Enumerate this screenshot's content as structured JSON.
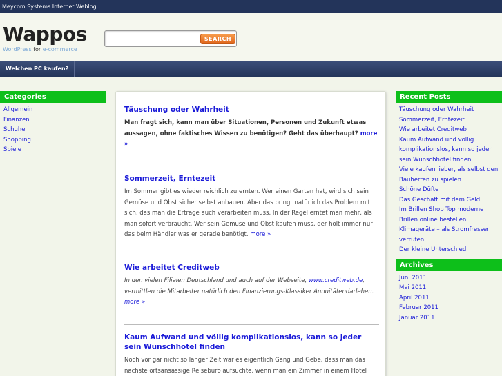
{
  "topbar": {
    "text": "Meycom Systems Internet Weblog"
  },
  "header": {
    "logo": "Wappos",
    "tagline_a": "WordPress",
    "tagline_for": "for",
    "tagline_b": "e-commerce",
    "search_value": "",
    "search_button": "SEARCH"
  },
  "nav": {
    "items": [
      {
        "label": "Welchen PC kaufen?"
      }
    ]
  },
  "categories": {
    "title": "Categories",
    "items": [
      "Allgemein",
      "Finanzen",
      "Schuhe",
      "Shopping",
      "Spiele"
    ]
  },
  "posts": [
    {
      "title": "Täuschung oder Wahrheit",
      "excerpt": "Man fragt sich, kann man über Situationen, Personen und Zukunft etwas aussagen, ohne faktisches Wissen zu benötigen? Geht das überhaupt?",
      "more": "more »"
    },
    {
      "title": "Sommerzeit, Erntezeit",
      "excerpt": "Im Sommer gibt es wieder reichlich zu ernten. Wer einen Garten hat, wird sich sein Gemüse und Obst sicher selbst anbauen. Aber das bringt natürlich das Problem mit sich, das man die Erträge auch verarbeiten muss. In der Regel erntet man mehr, als man sofort verbraucht. Wer sein Gemüse und Obst kaufen muss, der holt immer nur das beim Händler was er gerade benötigt.",
      "more": "more »"
    },
    {
      "title": "Wie arbeitet Creditweb",
      "excerpt_a": "In den vielen Filialen Deutschland und auch auf der Webseite,",
      "link": "www.creditweb.de",
      "excerpt_b": ", vermittlen die Mitarbeiter natürlich den Finanzierungs-Klassiker Annuitätendarlehen.",
      "more": "more »"
    },
    {
      "title": "Kaum Aufwand und völlig komplikationslos, kann so jeder sein Wunschhotel finden",
      "excerpt": "Noch vor gar nicht so langer Zeit war es eigentlich Gang und Gebe, dass man das nächste ortsansässige Reisebüro aufsuchte, wenn man ein Zimmer in einem Hotel"
    }
  ],
  "recent_posts": {
    "title": "Recent Posts",
    "items": [
      "Täuschung oder Wahrheit",
      "Sommerzeit, Erntezeit",
      "Wie arbeitet Creditweb",
      "Kaum Aufwand und völlig komplikationslos, kann so jeder sein Wunschhotel finden",
      "Viele kaufen lieber, als selbst den Bauherren zu spielen",
      "Schöne Düfte",
      "Das Geschäft mit dem Geld",
      "Im Brillen Shop Top moderne Brillen online bestellen",
      "Klimageräte – als Stromfresser verrufen",
      "Der kleine Unterschied"
    ]
  },
  "archives": {
    "title": "Archives",
    "items": [
      "Juni 2011",
      "Mai 2011",
      "April 2011",
      "Februar 2011",
      "Januar 2011"
    ]
  }
}
